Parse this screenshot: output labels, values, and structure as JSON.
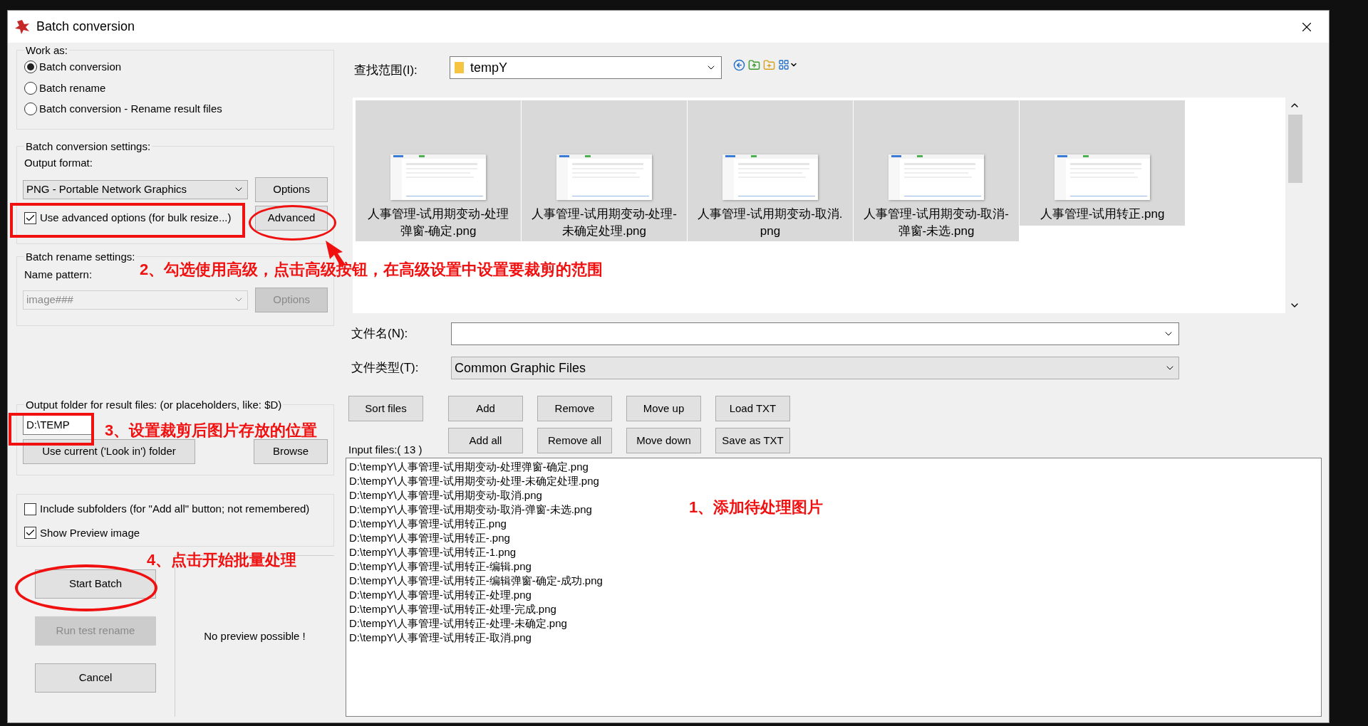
{
  "dialog": {
    "title": "Batch conversion"
  },
  "work_as": {
    "label": "Work as:",
    "options": [
      {
        "label": "Batch conversion",
        "selected": true
      },
      {
        "label": "Batch rename",
        "selected": false
      },
      {
        "label": "Batch conversion - Rename result files",
        "selected": false
      }
    ]
  },
  "conversion_settings": {
    "label": "Batch conversion settings:",
    "format_label": "Output format:",
    "format": "PNG - Portable Network Graphics",
    "options_button": "Options",
    "advanced_checkbox": {
      "label": "Use advanced options (for bulk resize...)",
      "checked": true
    },
    "advanced_button": "Advanced"
  },
  "rename_settings": {
    "label": "Batch rename settings:",
    "pattern_label": "Name pattern:",
    "pattern": "image###",
    "options_button": "Options",
    "disabled": true
  },
  "output_folder": {
    "label": "Output folder for result files: (or placeholders, like: $D)",
    "value": "D:\\TEMP",
    "use_current_button": "Use current ('Look in') folder",
    "browse_button": "Browse"
  },
  "checkboxes": [
    {
      "label": "Include subfolders (for \"Add all\" button; not remembered)",
      "checked": false
    },
    {
      "label": "Show Preview image",
      "checked": true
    }
  ],
  "actions": [
    {
      "label": "Start Batch",
      "disabled": false
    },
    {
      "label": "Run test rename",
      "disabled": true
    },
    {
      "label": "Cancel",
      "disabled": false
    }
  ],
  "preview": {
    "text": "No preview possible !"
  },
  "look_in": {
    "label": "查找范围(I):",
    "value": "tempY"
  },
  "thumbnails": [
    {
      "caption_lines": [
        "人事管理-试用期变动-处理",
        "弹窗-确定.png"
      ]
    },
    {
      "caption_lines": [
        "人事管理-试用期变动-处理-",
        "未确定处理.png"
      ]
    },
    {
      "caption_lines": [
        "人事管理-试用期变动-取消.",
        "png"
      ]
    },
    {
      "caption_lines": [
        "人事管理-试用期变动-取消-",
        "弹窗-未选.png"
      ]
    },
    {
      "caption_lines": [
        "人事管理-试用转正.png"
      ]
    }
  ],
  "file_name": {
    "label": "文件名(N):"
  },
  "file_type": {
    "label": "文件类型(T):",
    "value": "Common Graphic Files"
  },
  "sort_button": "Sort files",
  "input_files_label": "Input files:( 13 )",
  "list_buttons": [
    "Add",
    "Remove",
    "Move up",
    "Load TXT",
    "Add all",
    "Remove all",
    "Move down",
    "Save as TXT"
  ],
  "input_files": [
    "D:\\tempY\\人事管理-试用期变动-处理弹窗-确定.png",
    "D:\\tempY\\人事管理-试用期变动-处理-未确定处理.png",
    "D:\\tempY\\人事管理-试用期变动-取消.png",
    "D:\\tempY\\人事管理-试用期变动-取消-弹窗-未选.png",
    "D:\\tempY\\人事管理-试用转正.png",
    "D:\\tempY\\人事管理-试用转正-.png",
    "D:\\tempY\\人事管理-试用转正-1.png",
    "D:\\tempY\\人事管理-试用转正-编辑.png",
    "D:\\tempY\\人事管理-试用转正-编辑弹窗-确定-成功.png",
    "D:\\tempY\\人事管理-试用转正-处理.png",
    "D:\\tempY\\人事管理-试用转正-处理-完成.png",
    "D:\\tempY\\人事管理-试用转正-处理-未确定.png",
    "D:\\tempY\\人事管理-试用转正-取消.png"
  ],
  "annotations": [
    {
      "text": "1、添加待处理图片"
    },
    {
      "text": "2、勾选使用高级，点击高级按钮，在高级设置中设置要裁剪的范围"
    },
    {
      "text": "3、设置裁剪后图片存放的位置"
    },
    {
      "text": "4、点击开始批量处理"
    }
  ]
}
